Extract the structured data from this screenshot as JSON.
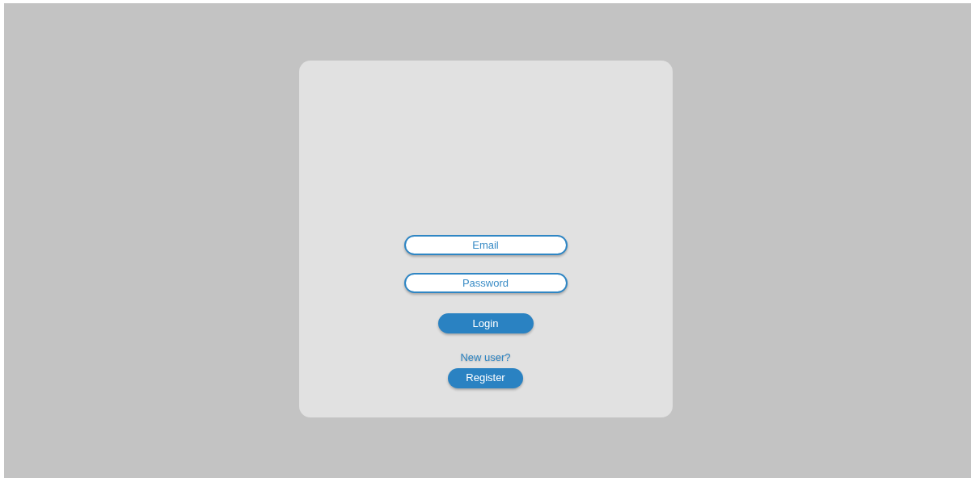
{
  "login_card": {
    "fields": [
      {
        "placeholder": "Email"
      },
      {
        "placeholder": "Password"
      }
    ],
    "login_button": "Login",
    "prompt": "New user?",
    "register_button": "Register"
  }
}
